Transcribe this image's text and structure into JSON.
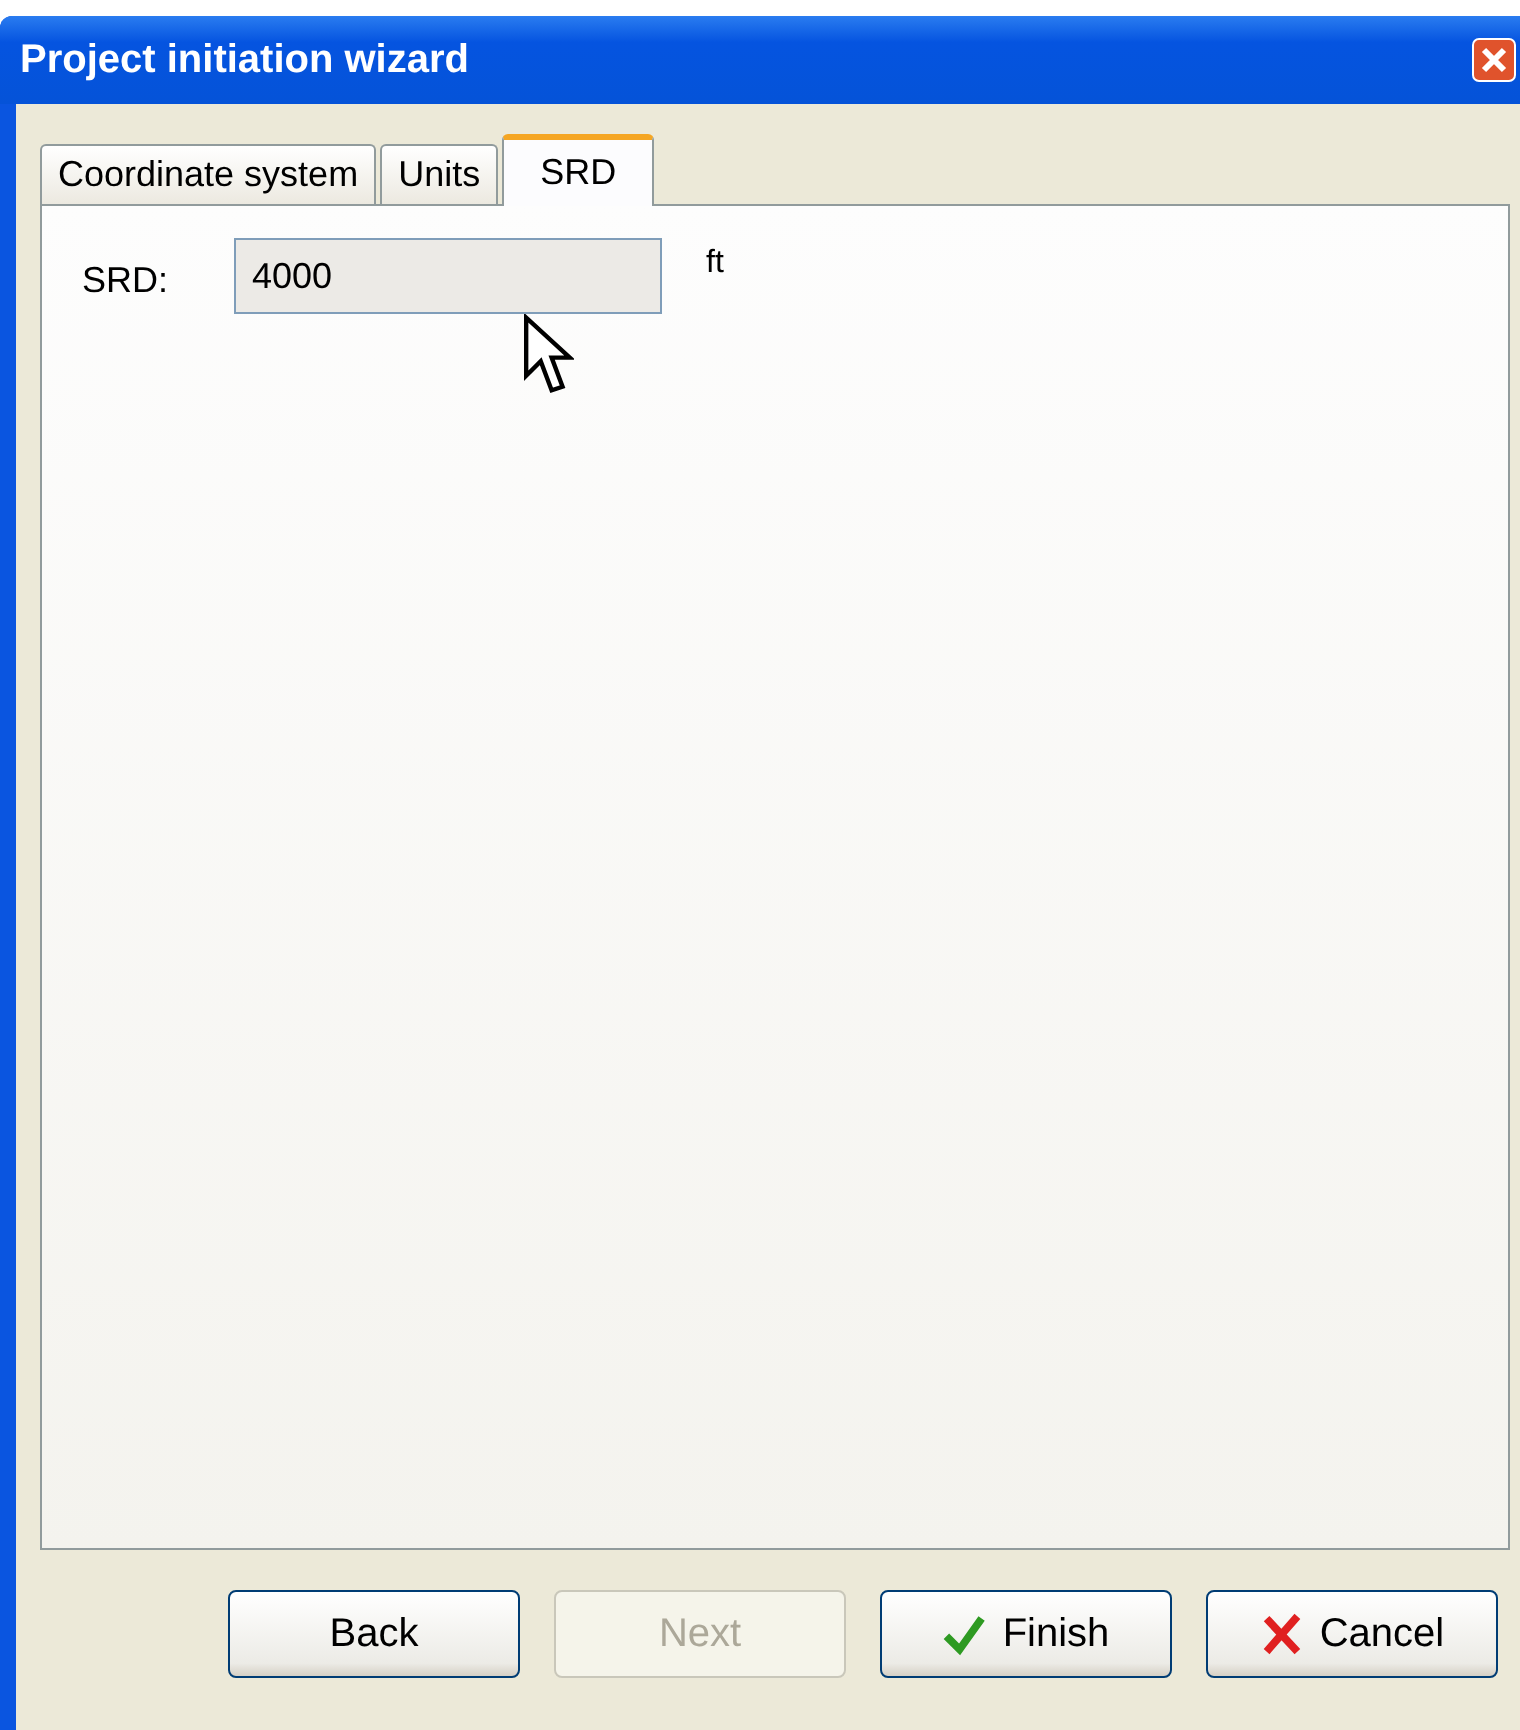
{
  "window": {
    "title": "Project initiation wizard"
  },
  "tabs": [
    {
      "label": "Coordinate system",
      "selected": false
    },
    {
      "label": "Units",
      "selected": false
    },
    {
      "label": "SRD",
      "selected": true
    }
  ],
  "field": {
    "label": "SRD:",
    "value": "4000",
    "unit": "ft"
  },
  "buttons": [
    {
      "label": "Back",
      "kind": "plain",
      "disabled": false
    },
    {
      "label": "Next",
      "kind": "plain",
      "disabled": true
    },
    {
      "label": "Finish",
      "kind": "check",
      "disabled": false
    },
    {
      "label": "Cancel",
      "kind": "cross",
      "disabled": false
    }
  ]
}
